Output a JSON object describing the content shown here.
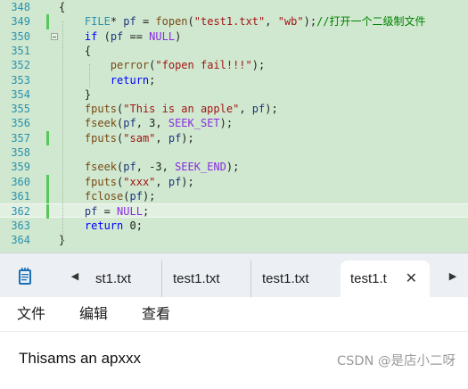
{
  "editor": {
    "lines": [
      {
        "num": "348",
        "tokens": [
          {
            "t": "{",
            "c": "plain"
          }
        ]
      },
      {
        "num": "349",
        "tokens": [
          {
            "t": "    ",
            "c": "plain"
          },
          {
            "t": "FILE",
            "c": "type"
          },
          {
            "t": "* ",
            "c": "plain"
          },
          {
            "t": "pf",
            "c": "var"
          },
          {
            "t": " = ",
            "c": "plain"
          },
          {
            "t": "fopen",
            "c": "fn"
          },
          {
            "t": "(",
            "c": "plain"
          },
          {
            "t": "\"test1.txt\"",
            "c": "string"
          },
          {
            "t": ", ",
            "c": "plain"
          },
          {
            "t": "\"wb\"",
            "c": "string"
          },
          {
            "t": ");",
            "c": "plain"
          },
          {
            "t": "//打开一个二级制文件",
            "c": "comment"
          }
        ]
      },
      {
        "num": "350",
        "tokens": [
          {
            "t": "    ",
            "c": "plain"
          },
          {
            "t": "if",
            "c": "keyword"
          },
          {
            "t": " (",
            "c": "plain"
          },
          {
            "t": "pf",
            "c": "var"
          },
          {
            "t": " == ",
            "c": "plain"
          },
          {
            "t": "NULL",
            "c": "macro"
          },
          {
            "t": ")",
            "c": "plain"
          }
        ]
      },
      {
        "num": "351",
        "tokens": [
          {
            "t": "    {",
            "c": "plain"
          }
        ]
      },
      {
        "num": "352",
        "tokens": [
          {
            "t": "        ",
            "c": "plain"
          },
          {
            "t": "perror",
            "c": "fn"
          },
          {
            "t": "(",
            "c": "plain"
          },
          {
            "t": "\"fopen fail!!!\"",
            "c": "string"
          },
          {
            "t": ");",
            "c": "plain"
          }
        ]
      },
      {
        "num": "353",
        "tokens": [
          {
            "t": "        ",
            "c": "plain"
          },
          {
            "t": "return",
            "c": "keyword"
          },
          {
            "t": ";",
            "c": "plain"
          }
        ]
      },
      {
        "num": "354",
        "tokens": [
          {
            "t": "    }",
            "c": "plain"
          }
        ]
      },
      {
        "num": "355",
        "tokens": [
          {
            "t": "    ",
            "c": "plain"
          },
          {
            "t": "fputs",
            "c": "fn"
          },
          {
            "t": "(",
            "c": "plain"
          },
          {
            "t": "\"This is an apple\"",
            "c": "string"
          },
          {
            "t": ", ",
            "c": "plain"
          },
          {
            "t": "pf",
            "c": "var"
          },
          {
            "t": ");",
            "c": "plain"
          }
        ]
      },
      {
        "num": "356",
        "tokens": [
          {
            "t": "    ",
            "c": "plain"
          },
          {
            "t": "fseek",
            "c": "fn"
          },
          {
            "t": "(",
            "c": "plain"
          },
          {
            "t": "pf",
            "c": "var"
          },
          {
            "t": ", 3, ",
            "c": "plain"
          },
          {
            "t": "SEEK_SET",
            "c": "macro"
          },
          {
            "t": ");",
            "c": "plain"
          }
        ]
      },
      {
        "num": "357",
        "tokens": [
          {
            "t": "    ",
            "c": "plain"
          },
          {
            "t": "fputs",
            "c": "fn"
          },
          {
            "t": "(",
            "c": "plain"
          },
          {
            "t": "\"sam\"",
            "c": "string"
          },
          {
            "t": ", ",
            "c": "plain"
          },
          {
            "t": "pf",
            "c": "var"
          },
          {
            "t": ");",
            "c": "plain"
          }
        ]
      },
      {
        "num": "358",
        "tokens": []
      },
      {
        "num": "359",
        "tokens": [
          {
            "t": "    ",
            "c": "plain"
          },
          {
            "t": "fseek",
            "c": "fn"
          },
          {
            "t": "(",
            "c": "plain"
          },
          {
            "t": "pf",
            "c": "var"
          },
          {
            "t": ", -3, ",
            "c": "plain"
          },
          {
            "t": "SEEK_END",
            "c": "macro"
          },
          {
            "t": ");",
            "c": "plain"
          }
        ]
      },
      {
        "num": "360",
        "tokens": [
          {
            "t": "    ",
            "c": "plain"
          },
          {
            "t": "fputs",
            "c": "fn"
          },
          {
            "t": "(",
            "c": "plain"
          },
          {
            "t": "\"xxx\"",
            "c": "string"
          },
          {
            "t": ", ",
            "c": "plain"
          },
          {
            "t": "pf",
            "c": "var"
          },
          {
            "t": ");",
            "c": "plain"
          }
        ]
      },
      {
        "num": "361",
        "tokens": [
          {
            "t": "    ",
            "c": "plain"
          },
          {
            "t": "fclose",
            "c": "fn"
          },
          {
            "t": "(",
            "c": "plain"
          },
          {
            "t": "pf",
            "c": "var"
          },
          {
            "t": ");",
            "c": "plain"
          }
        ]
      },
      {
        "num": "362",
        "tokens": [
          {
            "t": "    ",
            "c": "plain"
          },
          {
            "t": "pf",
            "c": "var"
          },
          {
            "t": " = ",
            "c": "plain"
          },
          {
            "t": "NULL",
            "c": "macro"
          },
          {
            "t": ";",
            "c": "plain"
          }
        ]
      },
      {
        "num": "363",
        "tokens": [
          {
            "t": "    ",
            "c": "plain"
          },
          {
            "t": "return",
            "c": "keyword"
          },
          {
            "t": " 0;",
            "c": "plain"
          }
        ]
      },
      {
        "num": "364",
        "tokens": [
          {
            "t": "}",
            "c": "plain"
          }
        ]
      }
    ],
    "modified_lines": [
      "349",
      "357",
      "360",
      "361",
      "362"
    ],
    "current_line": "362",
    "fold_marker_line": "350",
    "colors": {
      "background": "#cfe8cf",
      "line_numbers": "#2b91af",
      "modified_bar": "#58c858"
    }
  },
  "notepad": {
    "tabs": [
      {
        "label": "st1.txt",
        "active": false
      },
      {
        "label": "test1.txt",
        "active": false
      },
      {
        "label": "test1.txt",
        "active": false
      },
      {
        "label": "test1.t",
        "active": true
      }
    ],
    "icons": {
      "app": "notepad-icon",
      "scroll_left": "chevron-left-icon",
      "scroll_right": "chevron-right-icon",
      "close": "close-icon"
    },
    "close_glyph": "✕",
    "menu": {
      "file": "文件",
      "edit": "编辑",
      "view": "查看"
    },
    "content": "Thisams an apxxx"
  },
  "watermark": "CSDN @是店小二呀"
}
